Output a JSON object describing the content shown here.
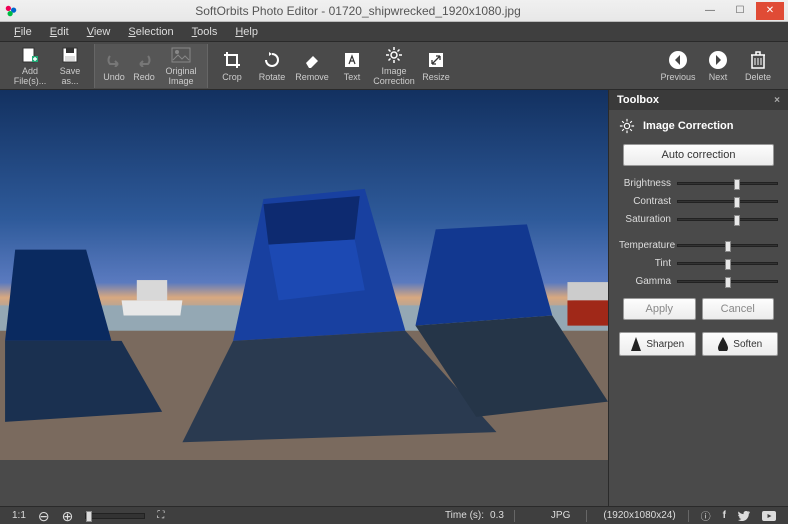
{
  "window": {
    "title": "SoftOrbits Photo Editor - 01720_shipwrecked_1920x1080.jpg"
  },
  "menu": {
    "file": "File",
    "edit": "Edit",
    "view": "View",
    "selection": "Selection",
    "tools": "Tools",
    "help": "Help"
  },
  "toolbar": {
    "add_files": "Add File(s)...",
    "save_as": "Save as...",
    "undo": "Undo",
    "redo": "Redo",
    "original_image": "Original Image",
    "crop": "Crop",
    "rotate": "Rotate",
    "remove": "Remove",
    "text": "Text",
    "image_correction": "Image Correction",
    "resize": "Resize",
    "previous": "Previous",
    "next": "Next",
    "delete": "Delete"
  },
  "toolbox": {
    "header": "Toolbox",
    "section_title": "Image Correction",
    "auto": "Auto correction",
    "sliders": {
      "brightness": "Brightness",
      "contrast": "Contrast",
      "saturation": "Saturation",
      "temperature": "Temperature",
      "tint": "Tint",
      "gamma": "Gamma"
    },
    "apply": "Apply",
    "cancel": "Cancel",
    "sharpen": "Sharpen",
    "soften": "Soften"
  },
  "status": {
    "ratio": "1:1",
    "time_label": "Time (s):",
    "time_value": "0.3",
    "format": "JPG",
    "dimensions": "(1920x1080x24)"
  }
}
